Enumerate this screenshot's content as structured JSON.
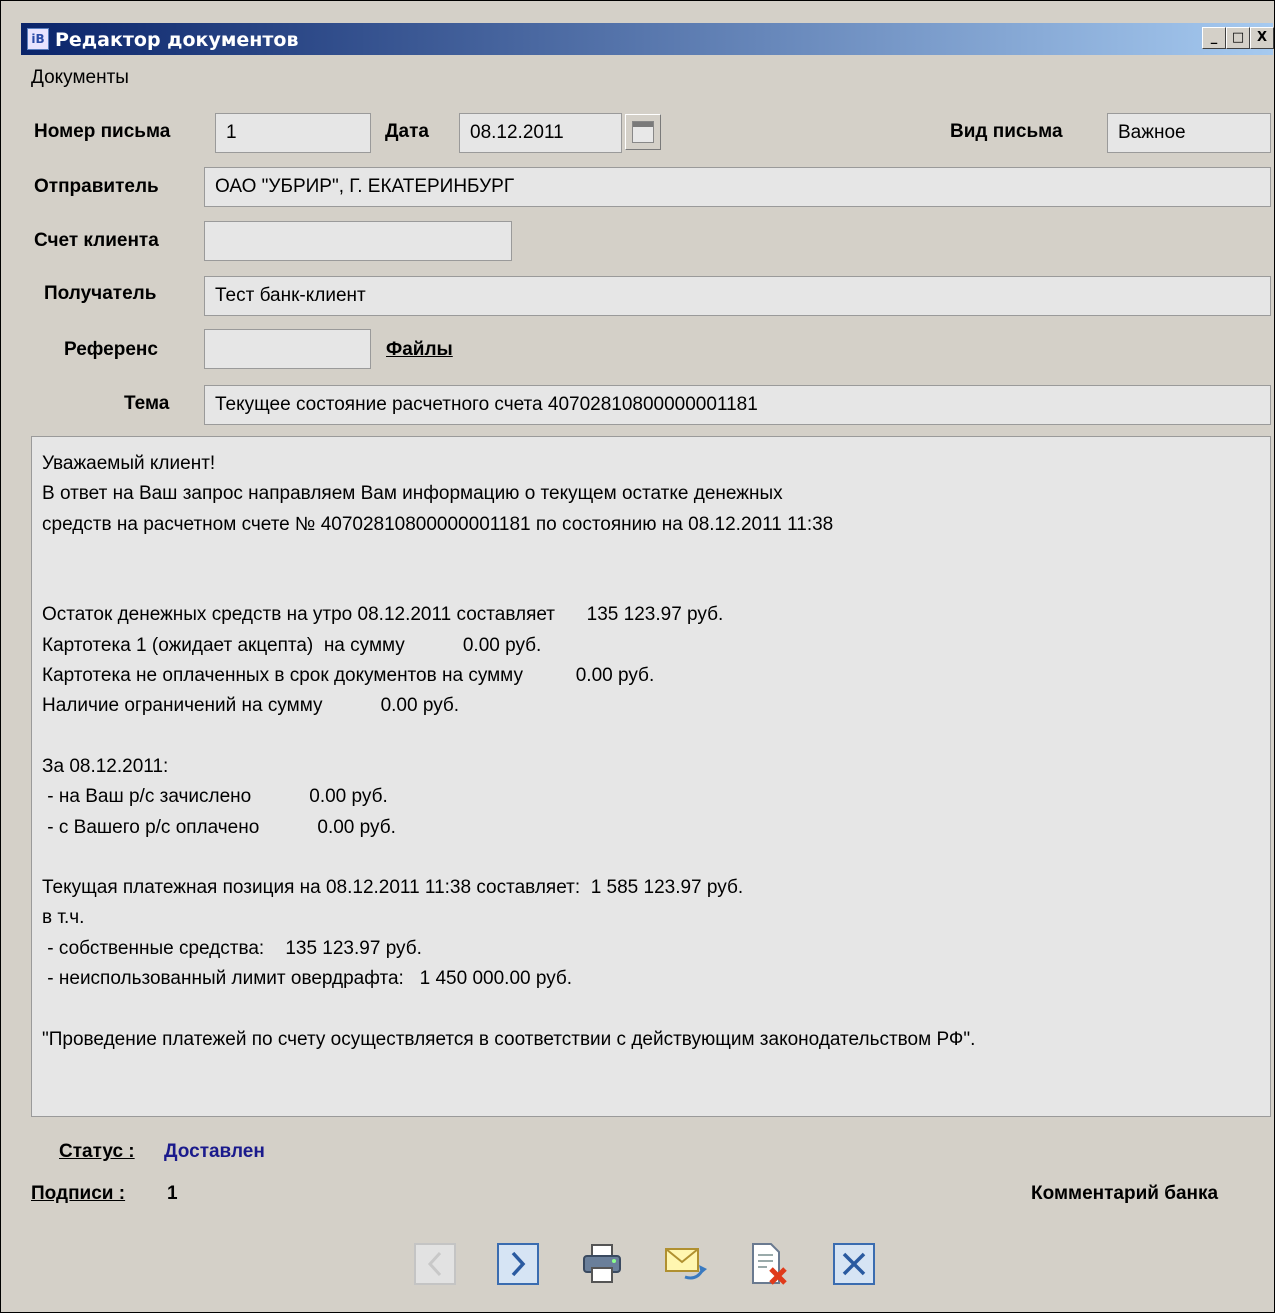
{
  "window": {
    "title": "Редактор документов",
    "app_icon": "app-icon",
    "buttons": {
      "minimize": "_",
      "maximize": "□",
      "close": "X"
    }
  },
  "menu": {
    "documents": "Документы"
  },
  "form": {
    "number_label": "Номер письма",
    "number_value": "1",
    "date_label": "Дата",
    "date_value": "08.12.2011",
    "type_label": "Вид письма",
    "type_value": "Важное",
    "sender_label": "Отправитель",
    "sender_value": "ОАО \"УБРИР\", Г. ЕКАТЕРИНБУРГ",
    "account_label": "Счет клиента",
    "account_value": "",
    "recipient_label": "Получатель",
    "recipient_value": "Тест банк-клиент",
    "reference_label": "Референс",
    "reference_value": "",
    "files_link": "Файлы",
    "subject_label": "Тема",
    "subject_value": "Текущее состояние расчетного счета 40702810800000001181"
  },
  "body": {
    "lines": [
      "Уважаемый клиент!",
      "В ответ на Ваш запрос направляем Вам информацию о текущем остатке денежных",
      "средств на расчетном счете № 40702810800000001181 по состоянию на 08.12.2011 11:38",
      "",
      "",
      "Остаток денежных средств на утро 08.12.2011 составляет      135 123.97 руб.",
      "Картотека 1 (ожидает акцепта)  на сумму           0.00 руб.",
      "Картотека не оплаченных в срок документов на сумму          0.00 руб.",
      "Наличие ограничений на сумму           0.00 руб.",
      "",
      "За 08.12.2011:",
      " - на Ваш р/с зачислено           0.00 руб.",
      " - с Вашего р/с оплачено           0.00 руб.",
      "",
      "Текущая платежная позиция на 08.12.2011 11:38 составляет:  1 585 123.97 руб.",
      "в т.ч.",
      " - собственные средства:    135 123.97 руб.",
      " - неиспользованный лимит овердрафта:   1 450 000.00 руб.",
      "",
      "\"Проведение платежей по счету осуществляется в соответствии с действующим законодательством РФ\"."
    ]
  },
  "footer": {
    "status_label": "Статус :",
    "status_value": "Доставлен",
    "signatures_label": "Подписи :",
    "signatures_value": "1",
    "bank_comment": "Комментарий банка"
  },
  "colors": {
    "status": "#1a1a8c",
    "window_bg": "#d4d0c8",
    "field_bg": "#e6e6e6",
    "title_start": "#0a246a",
    "title_end": "#a6caf0"
  },
  "toolbar": {
    "icons": [
      "prev-icon",
      "next-icon",
      "printer-icon",
      "envelope-reply-icon",
      "delete-document-icon",
      "close-icon"
    ]
  }
}
